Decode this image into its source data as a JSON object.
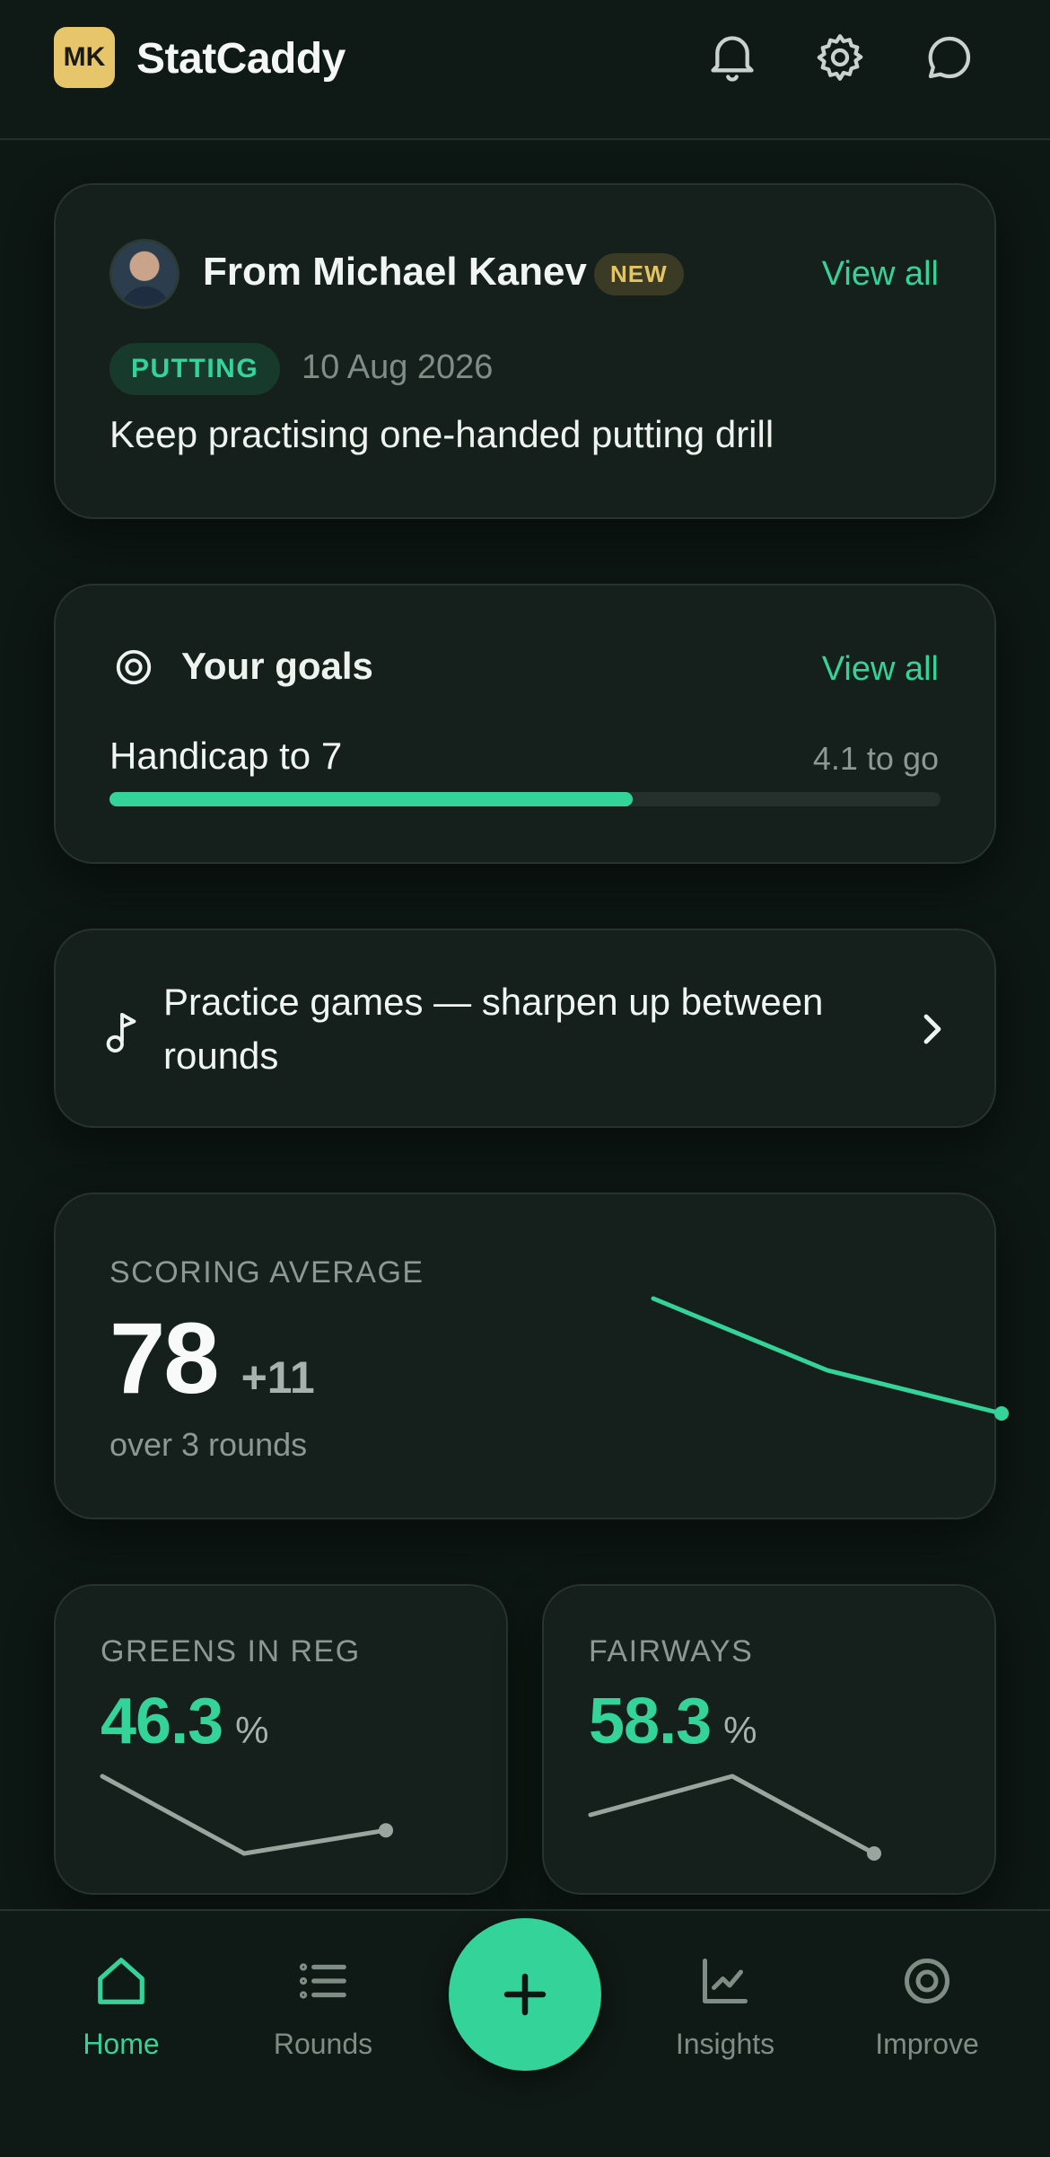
{
  "app": {
    "badge": "MK",
    "title": "StatCaddy"
  },
  "header_icons": [
    "bell-icon",
    "gear-icon",
    "chat-icon"
  ],
  "message": {
    "from": "From Michael Kanev",
    "badge": "NEW",
    "view_all": "View all",
    "tag": "PUTTING",
    "date": "10 Aug 2026",
    "body": "Keep practising one-handed putting drill"
  },
  "goals": {
    "title": "Your goals",
    "view_all": "View all",
    "goal_name": "Handicap to 7",
    "remaining": "4.1 to go",
    "progress": 0.63
  },
  "practice": {
    "text": "Practice games — sharpen up between rounds"
  },
  "scoring": {
    "label": "SCORING AVERAGE",
    "value": "78",
    "delta": "+11",
    "sub": "over 3 rounds",
    "trend": [
      81,
      76,
      73
    ]
  },
  "greens": {
    "label": "GREENS IN REG",
    "value": "46.3",
    "unit": "%",
    "trend": [
      50,
      40,
      43
    ]
  },
  "fairways": {
    "label": "FAIRWAYS",
    "value": "58.3",
    "unit": "%",
    "trend": [
      55,
      60,
      50
    ]
  },
  "nav": {
    "home": "Home",
    "rounds": "Rounds",
    "insights": "Insights",
    "improve": "Improve"
  },
  "colors": {
    "accent": "#34d399",
    "background": "#0d1713",
    "card": "#15201c",
    "badge_gold": "#e6c56b"
  }
}
